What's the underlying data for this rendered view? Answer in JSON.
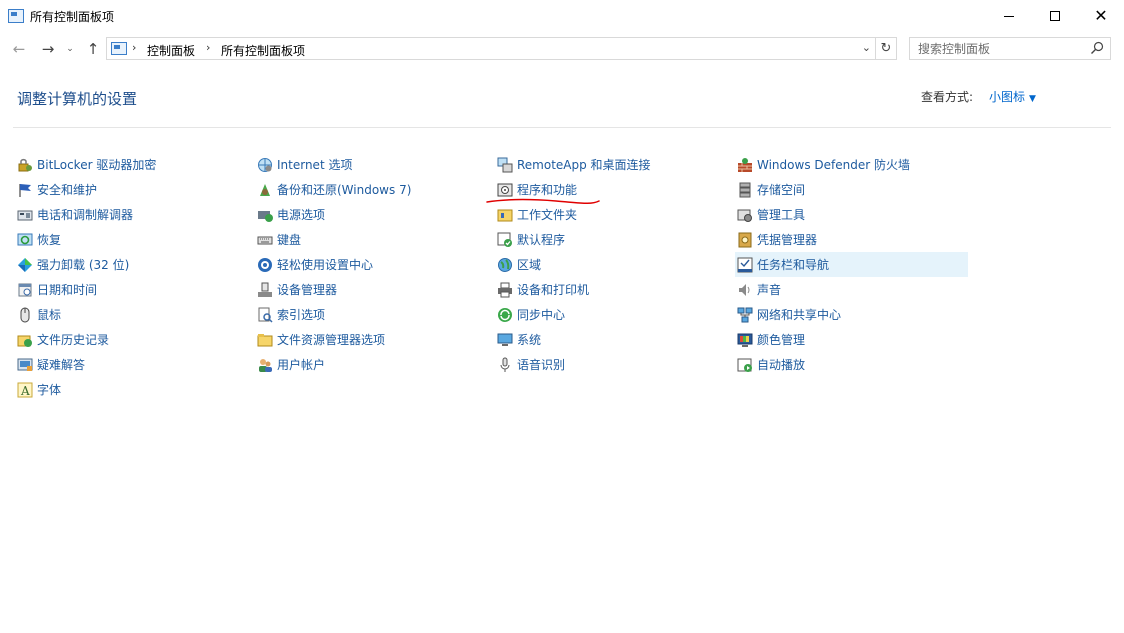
{
  "window": {
    "title": "所有控制面板项",
    "minimize_icon": "minimize-icon",
    "maximize_icon": "maximize-icon",
    "close_icon": "close-icon"
  },
  "address_bar": {
    "breadcrumb": [
      "控制面板",
      "所有控制面板项"
    ],
    "search_placeholder": "搜索控制面板"
  },
  "header": {
    "title": "调整计算机的设置",
    "view_by_label": "查看方式:",
    "view_by_value": "小图标"
  },
  "columns": [
    [
      {
        "label": "BitLocker 驱动器加密",
        "icon": "bitlocker-icon"
      },
      {
        "label": "安全和维护",
        "icon": "flag-icon"
      },
      {
        "label": "电话和调制解调器",
        "icon": "phone-modem-icon"
      },
      {
        "label": "恢复",
        "icon": "recovery-icon"
      },
      {
        "label": "强力卸载 (32 位)",
        "icon": "uninstaller-icon"
      },
      {
        "label": "日期和时间",
        "icon": "datetime-icon"
      },
      {
        "label": "鼠标",
        "icon": "mouse-icon"
      },
      {
        "label": "文件历史记录",
        "icon": "file-history-icon"
      },
      {
        "label": "疑难解答",
        "icon": "troubleshoot-icon"
      },
      {
        "label": "字体",
        "icon": "fonts-icon"
      }
    ],
    [
      {
        "label": "Internet 选项",
        "icon": "internet-options-icon"
      },
      {
        "label": "备份和还原(Windows 7)",
        "icon": "backup-icon"
      },
      {
        "label": "电源选项",
        "icon": "power-icon"
      },
      {
        "label": "键盘",
        "icon": "keyboard-icon"
      },
      {
        "label": "轻松使用设置中心",
        "icon": "ease-of-access-icon"
      },
      {
        "label": "设备管理器",
        "icon": "device-manager-icon"
      },
      {
        "label": "索引选项",
        "icon": "indexing-icon"
      },
      {
        "label": "文件资源管理器选项",
        "icon": "folder-options-icon"
      },
      {
        "label": "用户帐户",
        "icon": "user-accounts-icon"
      }
    ],
    [
      {
        "label": "RemoteApp 和桌面连接",
        "icon": "remoteapp-icon"
      },
      {
        "label": "程序和功能",
        "icon": "programs-icon"
      },
      {
        "label": "工作文件夹",
        "icon": "work-folders-icon"
      },
      {
        "label": "默认程序",
        "icon": "default-programs-icon"
      },
      {
        "label": "区域",
        "icon": "region-icon"
      },
      {
        "label": "设备和打印机",
        "icon": "printer-icon"
      },
      {
        "label": "同步中心",
        "icon": "sync-icon"
      },
      {
        "label": "系统",
        "icon": "system-icon"
      },
      {
        "label": "语音识别",
        "icon": "microphone-icon"
      }
    ],
    [
      {
        "label": "Windows Defender 防火墙",
        "icon": "firewall-icon"
      },
      {
        "label": "存储空间",
        "icon": "storage-icon"
      },
      {
        "label": "管理工具",
        "icon": "admin-tools-icon"
      },
      {
        "label": "凭据管理器",
        "icon": "credential-icon"
      },
      {
        "label": "任务栏和导航",
        "icon": "taskbar-icon",
        "highlighted": true
      },
      {
        "label": "声音",
        "icon": "sound-icon"
      },
      {
        "label": "网络和共享中心",
        "icon": "network-icon"
      },
      {
        "label": "颜色管理",
        "icon": "color-management-icon"
      },
      {
        "label": "自动播放",
        "icon": "autoplay-icon"
      }
    ]
  ],
  "annotation": {
    "color": "#e00000",
    "target": "程序和功能"
  }
}
